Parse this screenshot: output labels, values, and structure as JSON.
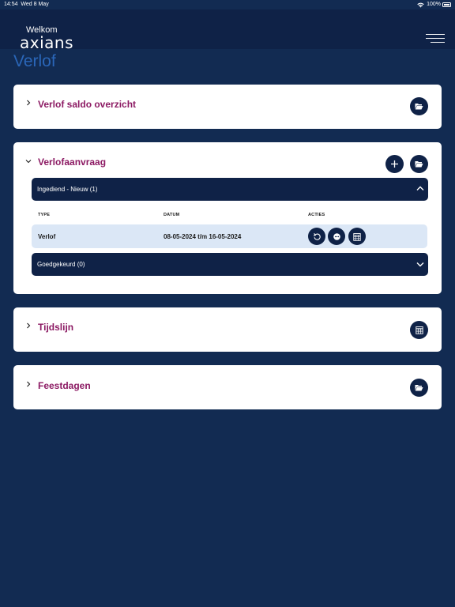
{
  "status": {
    "time": "14:54",
    "date": "Wed 8 May",
    "battery": "100%"
  },
  "header": {
    "welcome": "Welkom",
    "logo": "axians",
    "menu_icon": "hamburger-menu-icon"
  },
  "page": {
    "title": "Verlof"
  },
  "cards": {
    "saldo": {
      "title": "Verlof saldo overzicht",
      "expanded": false,
      "action_icon": "folder-open-icon"
    },
    "aanvraag": {
      "title": "Verlofaanvraag",
      "expanded": true,
      "action_icons": [
        "plus-icon",
        "folder-open-icon"
      ],
      "submitted": {
        "label": "Ingediend - Nieuw (1)",
        "expanded": true
      },
      "columns": {
        "type": "TYPE",
        "date": "DATUM",
        "actions": "ACTIES"
      },
      "rows": [
        {
          "type": "Verlof",
          "date": "08-05-2024 t/m 16-05-2024",
          "actions": [
            "undo-icon",
            "comment-icon",
            "calendar-icon"
          ]
        }
      ],
      "approved": {
        "label": "Goedgekeurd (0)",
        "expanded": false
      }
    },
    "tijdslijn": {
      "title": "Tijdslijn",
      "expanded": false,
      "action_icon": "calendar-icon"
    },
    "feestdagen": {
      "title": "Feestdagen",
      "expanded": false,
      "action_icon": "folder-open-icon"
    }
  },
  "colors": {
    "background": "#122b52",
    "header": "#0f2247",
    "accent_title": "#2a66b8",
    "card_title": "#8c1a63",
    "row_highlight": "#dbe7f6"
  }
}
